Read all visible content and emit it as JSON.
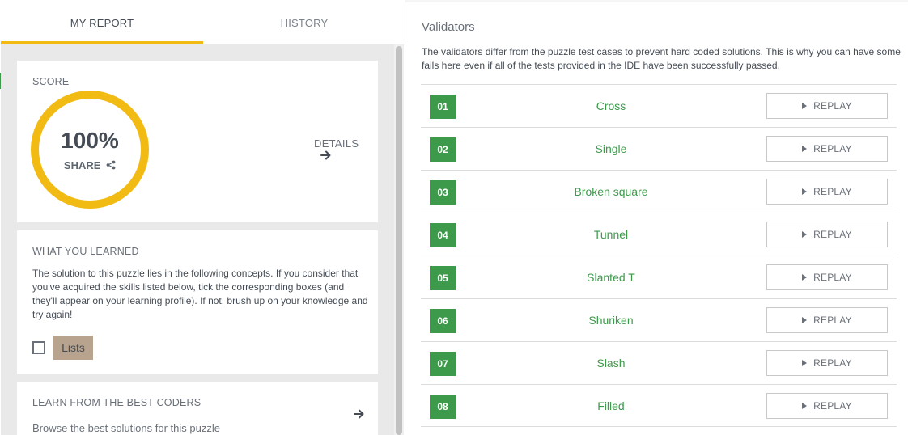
{
  "tabs": [
    {
      "label": "MY REPORT",
      "active": true
    },
    {
      "label": "HISTORY",
      "active": false
    }
  ],
  "score": {
    "title": "SCORE",
    "percent": "100%",
    "share_label": "SHARE",
    "details_label": "DETAILS"
  },
  "learned": {
    "title": "WHAT YOU LEARNED",
    "text": "The solution to this puzzle lies in the following concepts. If you consider that you've acquired the skills listed below, tick the corresponding boxes (and they'll appear on your learning profile). If not, brush up on your knowledge and try again!",
    "concept": "Lists",
    "concept_checked": false
  },
  "best": {
    "title": "LEARN FROM THE BEST CODERS",
    "text": "Browse the best solutions for this puzzle"
  },
  "validators": {
    "title": "Validators",
    "description": "The validators differ from the puzzle test cases to prevent hard coded solutions. This is why you can have some fails here even if all of the tests provided in the IDE have been successfully passed.",
    "replay_label": "REPLAY",
    "items": [
      {
        "num": "01",
        "name": "Cross"
      },
      {
        "num": "02",
        "name": "Single"
      },
      {
        "num": "03",
        "name": "Broken square"
      },
      {
        "num": "04",
        "name": "Tunnel"
      },
      {
        "num": "05",
        "name": "Slanted T"
      },
      {
        "num": "06",
        "name": "Shuriken"
      },
      {
        "num": "07",
        "name": "Slash"
      },
      {
        "num": "08",
        "name": "Filled"
      }
    ]
  },
  "colors": {
    "accent_yellow": "#f2bb13",
    "success_green": "#3d9a4b",
    "tag_tan": "#b8a48e"
  },
  "icons": {
    "share": "share-icon",
    "arrow": "arrow-right-icon",
    "play": "play-icon"
  }
}
